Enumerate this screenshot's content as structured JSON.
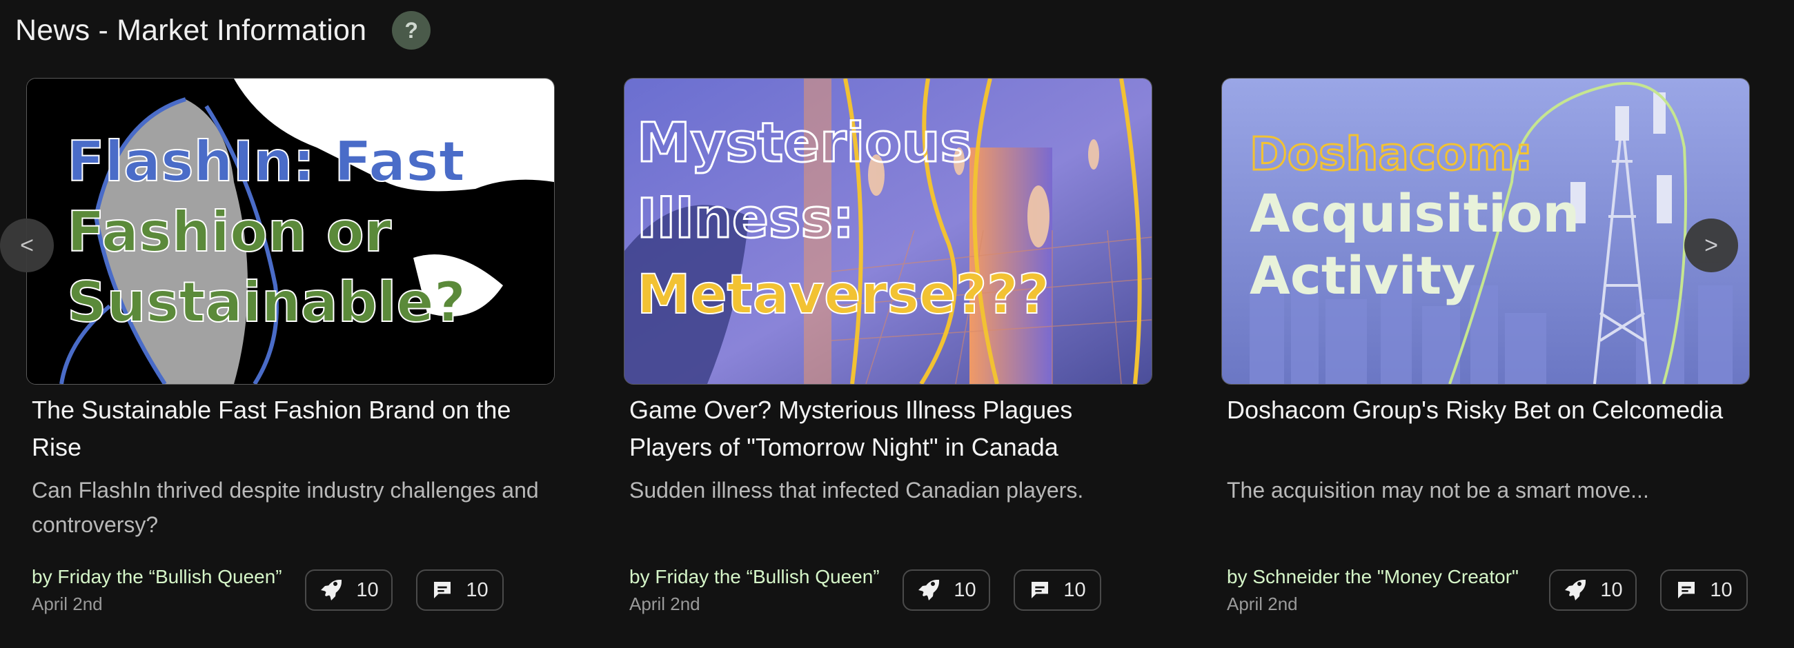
{
  "header": {
    "title": "News - Market Information",
    "help_label": "?"
  },
  "nav": {
    "prev_label": "<",
    "next_label": ">"
  },
  "cards": [
    {
      "image_lines": [
        "FlashIn: ",
        "Fast",
        "Fashion or",
        "Sustainable?"
      ],
      "headline": "The Sustainable Fast Fashion Brand on the Rise",
      "description": "Can FlashIn thrived despite industry challenges and controversy?",
      "author": "by Friday the “Bullish Queen”",
      "date": "April 2nd",
      "rocket_count": "10",
      "comment_count": "10"
    },
    {
      "image_lines": [
        "Mysterious",
        "Illness:",
        "Metaverse???"
      ],
      "headline": "Game Over? Mysterious Illness Plagues Players of \"Tomorrow Night\" in Canada",
      "description": "Sudden illness that infected Canadian players.",
      "author": "by Friday the “Bullish Queen”",
      "date": "April 2nd",
      "rocket_count": "10",
      "comment_count": "10"
    },
    {
      "image_lines": [
        "Doshacom:",
        "Acquisition",
        "Activity"
      ],
      "headline": "Doshacom Group's Risky Bet on Celcomedia",
      "description": "The acquisition may not be a smart move...",
      "author": "by Schneider the \"Money Creator\"",
      "date": "April 2nd",
      "rocket_count": "10",
      "comment_count": "10"
    }
  ],
  "icons": [
    "help-icon",
    "rocket-icon",
    "comment-icon",
    "chevron-left-icon",
    "chevron-right-icon"
  ],
  "colors": {
    "background": "#121212",
    "author": "#d5f5c8",
    "accent_blue": "#4a6cc8",
    "accent_green": "#5b8a3a",
    "accent_yellow": "#f2c233"
  }
}
